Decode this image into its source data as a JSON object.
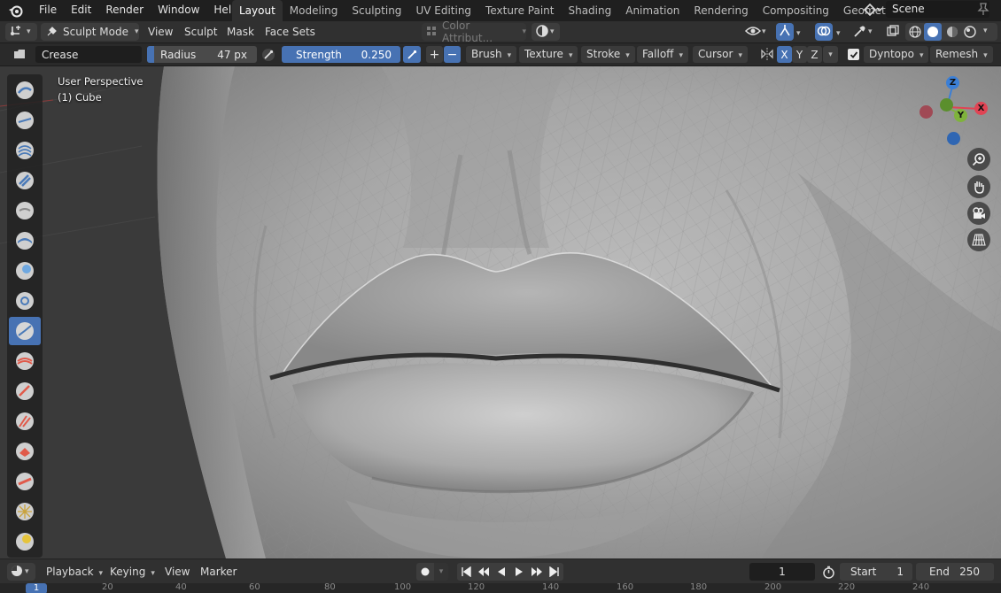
{
  "menu": {
    "file": "File",
    "edit": "Edit",
    "render": "Render",
    "window": "Window",
    "help": "Help"
  },
  "workspaces": [
    "Layout",
    "Modeling",
    "Sculpting",
    "UV Editing",
    "Texture Paint",
    "Shading",
    "Animation",
    "Rendering",
    "Compositing",
    "Geomet"
  ],
  "scene": {
    "name": "Scene"
  },
  "header": {
    "mode": "Sculpt Mode",
    "view": "View",
    "sculpt": "Sculpt",
    "mask": "Mask",
    "face_sets": "Face Sets",
    "color_attribute": "Color Attribut..."
  },
  "tool_settings": {
    "brush_name": "Crease",
    "radius_label": "Radius",
    "radius_value": "47 px",
    "strength_label": "Strength",
    "strength_value": "0.250",
    "plus": "+",
    "minus": "−",
    "brush": "Brush",
    "texture": "Texture",
    "stroke": "Stroke",
    "falloff": "Falloff",
    "cursor": "Cursor",
    "axis_x": "X",
    "axis_y": "Y",
    "axis_z": "Z",
    "dyntopo": "Dyntopo",
    "remesh": "Remesh"
  },
  "viewport": {
    "perspective": "User Perspective",
    "object": "(1) Cube"
  },
  "gizmo": {
    "x": "X",
    "y": "Y",
    "z": "Z",
    "x_color": "#e04454",
    "y_color": "#7fb33b",
    "z_color": "#3b7fd6"
  },
  "timeline": {
    "playback": "Playback",
    "keying": "Keying",
    "view": "View",
    "marker": "Marker",
    "current_frame": "1",
    "start_label": "Start",
    "start_value": "1",
    "end_label": "End",
    "end_value": "250"
  },
  "ruler": {
    "current": "1",
    "ticks": [
      "20",
      "40",
      "60",
      "80",
      "100",
      "120",
      "140",
      "160",
      "180",
      "200",
      "220",
      "240"
    ]
  },
  "colors": {
    "accent": "#4772b3",
    "header_bg": "#303030",
    "topbar_bg": "#1f1f1f"
  }
}
